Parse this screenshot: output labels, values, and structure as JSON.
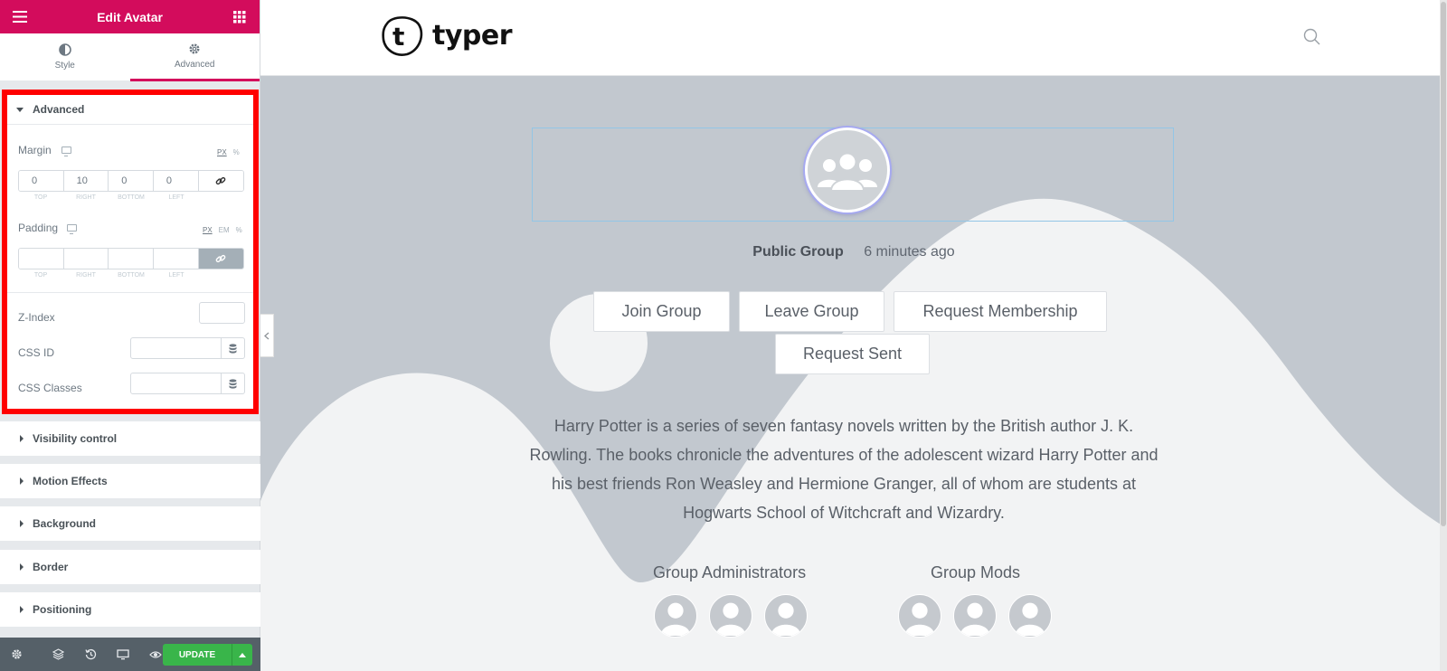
{
  "panel": {
    "title": "Edit Avatar",
    "tabs": [
      {
        "label": "Style",
        "icon": "contrast-icon"
      },
      {
        "label": "Advanced",
        "icon": "gear-icon"
      }
    ],
    "advanced": {
      "title": "Advanced",
      "margin": {
        "label": "Margin",
        "units": [
          "PX",
          "%"
        ],
        "values": [
          "0",
          "10",
          "0",
          "0"
        ],
        "sides": [
          "TOP",
          "RIGHT",
          "BOTTOM",
          "LEFT"
        ]
      },
      "padding": {
        "label": "Padding",
        "units": [
          "PX",
          "EM",
          "%"
        ],
        "values": [
          "",
          "",
          "",
          ""
        ],
        "sides": [
          "TOP",
          "RIGHT",
          "BOTTOM",
          "LEFT"
        ]
      },
      "z_index_label": "Z-Index",
      "css_id_label": "CSS ID",
      "css_classes_label": "CSS Classes"
    },
    "sections": [
      "Visibility control",
      "Motion Effects",
      "Background",
      "Border",
      "Positioning"
    ],
    "footer": {
      "update_label": "UPDATE"
    }
  },
  "site": {
    "logo_text": "typer",
    "logo_letter": "t"
  },
  "group": {
    "type": "Public Group",
    "time": "6 minutes ago",
    "buttons": [
      "Join Group",
      "Leave Group",
      "Request Membership",
      "Request Sent"
    ],
    "description": "Harry Potter is a series of seven fantasy novels written by the British author J. K. Rowling. The books chronicle the adventures of the adolescent wizard Harry Potter and his best friends Ron Weasley and Hermione Granger, all of whom are students at Hogwarts School of Witchcraft and Wizardry.",
    "administrators_title": "Group Administrators",
    "mods_title": "Group Mods"
  },
  "colors": {
    "brand": "#d30c5c",
    "update": "#39b54a",
    "highlight": "#ff0000"
  }
}
